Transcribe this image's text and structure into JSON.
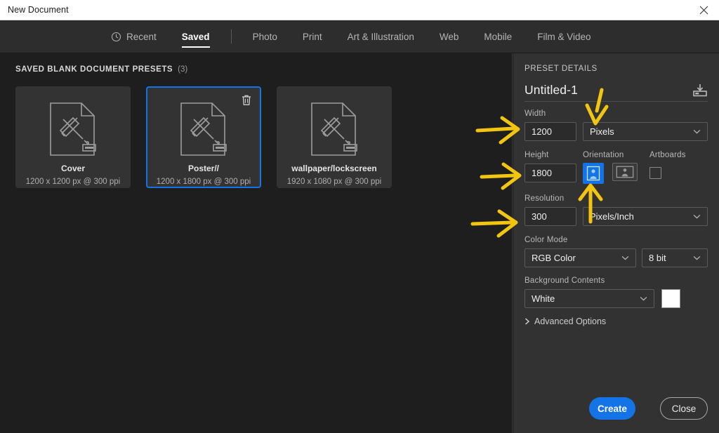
{
  "window": {
    "title": "New Document",
    "close_icon": "close-icon"
  },
  "tabs": {
    "items": [
      {
        "label": "Recent",
        "icon": "clock-icon",
        "active": false
      },
      {
        "label": "Saved",
        "icon": "",
        "active": true
      },
      {
        "label": "Photo",
        "icon": "",
        "active": false
      },
      {
        "label": "Print",
        "icon": "",
        "active": false
      },
      {
        "label": "Art & Illustration",
        "icon": "",
        "active": false
      },
      {
        "label": "Web",
        "icon": "",
        "active": false
      },
      {
        "label": "Mobile",
        "icon": "",
        "active": false
      },
      {
        "label": "Film & Video",
        "icon": "",
        "active": false
      }
    ]
  },
  "presets": {
    "section_label": "SAVED BLANK DOCUMENT PRESETS",
    "count_label": "(3)",
    "cards": [
      {
        "name": "Cover",
        "dimensions": "1200 x 1200 px @ 300 ppi",
        "selected": false,
        "has_trash": false
      },
      {
        "name": "Poster//",
        "dimensions": "1200 x 1800 px @ 300 ppi",
        "selected": true,
        "has_trash": true
      },
      {
        "name": "wallpaper/lockscreen",
        "dimensions": "1920 x 1080 px @ 300 ppi",
        "selected": false,
        "has_trash": false
      }
    ]
  },
  "details": {
    "panel_title": "PRESET DETAILS",
    "document_name": "Untitled-1",
    "save_preset_icon": "save-preset-icon",
    "width_label": "Width",
    "width_value": "1200",
    "width_unit": "Pixels",
    "height_label": "Height",
    "height_value": "1800",
    "orientation_label": "Orientation",
    "orientation_portrait": "portrait-icon",
    "orientation_landscape": "landscape-icon",
    "artboards_label": "Artboards",
    "resolution_label": "Resolution",
    "resolution_value": "300",
    "resolution_unit": "Pixels/Inch",
    "color_mode_label": "Color Mode",
    "color_mode_value": "RGB Color",
    "bit_depth_value": "8 bit",
    "background_label": "Background Contents",
    "background_value": "White",
    "background_swatch_color": "#ffffff",
    "advanced_label": "Advanced Options",
    "create_label": "Create",
    "close_label": "Close"
  },
  "annotations": {
    "color": "#f2c511",
    "items": [
      {
        "name": "arrow-to-width-field",
        "type": "arrow-right"
      },
      {
        "name": "arrow-to-height-field",
        "type": "arrow-right"
      },
      {
        "name": "arrow-to-resolution-field",
        "type": "arrow-right"
      },
      {
        "name": "arrow-to-width-unit",
        "type": "arrow-down"
      },
      {
        "name": "arrow-to-orientation-portrait",
        "type": "arrow-up"
      }
    ]
  },
  "theme": {
    "accent": "#1473e6",
    "panel_bg": "#323232",
    "canvas_bg": "#1e1e1e",
    "tabbar_bg": "#2d2d2d"
  }
}
